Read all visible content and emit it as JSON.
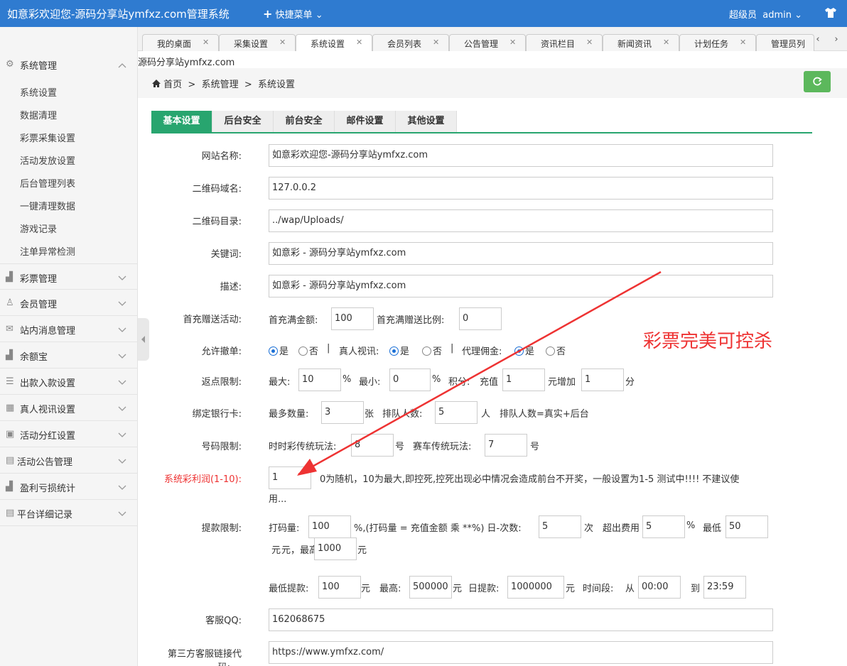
{
  "app_title": "如意彩欢迎您-源码分享站ymfxz.com管理系统",
  "quick_menu": "快捷菜单",
  "user": {
    "role": "超级员",
    "name": "admin"
  },
  "tabs": [
    "我的桌面",
    "采集设置",
    "系统设置",
    "会员列表",
    "公告管理",
    "资讯栏目",
    "新闻资讯",
    "计划任务",
    "管理员列"
  ],
  "tab_active": 2,
  "subtitle": "源码分享站ymfxz.com",
  "breadcrumb": {
    "home": "首页",
    "l1": "系统管理",
    "l2": "系统设置",
    "sep": ">"
  },
  "sidebar": {
    "groups": [
      "系统管理",
      "彩票管理",
      "会员管理",
      "站内消息管理",
      "余额宝",
      "出款入款设置",
      "真人视讯设置",
      "活动分红设置",
      "活动公告管理",
      "盈利亏损统计",
      "平台详细记录"
    ],
    "sub_items": [
      "系统设置",
      "数据清理",
      "彩票采集设置",
      "活动发放设置",
      "后台管理列表",
      "一键清理数据",
      "游戏记录",
      "注单异常检测"
    ]
  },
  "form_tabs": [
    "基本设置",
    "后台安全",
    "前台安全",
    "邮件设置",
    "其他设置"
  ],
  "form": {
    "site_name_label": "网站名称:",
    "site_name": "如意彩欢迎您-源码分享站ymfxz.com",
    "qr_domain_label": "二维码域名:",
    "qr_domain": "127.0.0.2",
    "qr_dir_label": "二维码目录:",
    "qr_dir": "../wap/Uploads/",
    "keywords_label": "关键词:",
    "keywords": "如意彩 - 源码分享站ymfxz.com",
    "desc_label": "描述:",
    "desc": "如意彩 - 源码分享站ymfxz.com",
    "first_label": "首充赠送活动:",
    "first_full_label": "首充满金额:",
    "first_full": "100",
    "first_ratio_label": "首充满赠送比例:",
    "first_ratio": "0",
    "allow_label": "允许撤单:",
    "yes": "是",
    "no": "否",
    "live_label": "真人视讯:",
    "agent_label": "代理佣金:",
    "sep": "|",
    "rebate_label": "返点限制:",
    "max_label": "最大:",
    "max": "10",
    "pct": "%",
    "min_label": "最小:",
    "min": "0",
    "points_label": "积分:",
    "recharge_label": "充值",
    "recharge": "1",
    "add_label": "元增加",
    "add": "1",
    "fen": "分",
    "bank_label": "绑定银行卡:",
    "max_count_label": "最多数量:",
    "max_count": "3",
    "zhang": "张",
    "queue_label": "排队人数:",
    "queue": "5",
    "ren": "人",
    "queue_note": "排队人数=真实+后台",
    "num_label": "号码限制:",
    "ssc_label": "时时彩传统玩法:",
    "ssc": "8",
    "hao": "号",
    "race_label": "赛车传统玩法:",
    "race": "7",
    "profit_label": "系统彩利润(1-10):",
    "profit": "1",
    "profit_note1": "0为随机，10为最大,即控死,控死出现必中情况会造成前台不开奖，一般设置为1-5 测试中!!!! 不建议使",
    "profit_note2": "用...",
    "withdraw_label": "提款限制:",
    "bet_label": "打码量:",
    "bet": "100",
    "bet_note": "%,(打码量 = 充值金额 乘 **%) 日-次数:",
    "times": "5",
    "ci": "次",
    "fee_label": "超出费用",
    "fee": "5",
    "low_label": "最低",
    "low": "50",
    "yuan": "元",
    "high_label": "元，最高",
    "high": "1000",
    "min_wd_label": "最低提款:",
    "min_wd": "100",
    "max_wd_label": "最高:",
    "max_wd": "500000",
    "day_wd_label": "日提款:",
    "day_wd": "1000000",
    "period_label": "时间段:",
    "from": "从",
    "start": "00:00",
    "to": "到",
    "end": "23:59",
    "qq_label": "客服QQ:",
    "qq": "162068675",
    "third_label1": "第三方客服链接代",
    "third_label2": "码:",
    "third": "https://www.ymfxz.com/"
  },
  "annotation": "彩票完美可控杀"
}
